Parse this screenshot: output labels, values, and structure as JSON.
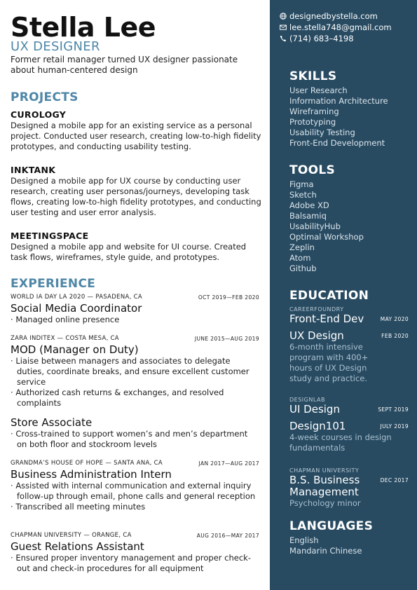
{
  "header": {
    "name": "Stella Lee",
    "role": "UX DESIGNER",
    "intro": "Former retail manager turned UX designer passionate about human-centered design"
  },
  "projects": {
    "title": "PROJECTS",
    "items": [
      {
        "name": "CUROLOGY",
        "desc": "Designed a mobile app for an existing service as a personal project. Conducted user research, creating low-to-high fidelity prototypes, and conducting usability testing."
      },
      {
        "name": "INKTANK",
        "desc": "Designed a mobile app for UX course by conducting user research, creating user personas/journeys, developing task flows, creating low-to-high fidelity prototypes, and conducting user testing and user error analysis."
      },
      {
        "name": "MEETINGSPACE",
        "desc": "Designed a mobile app and website for UI course.  Created task flows, wireframes, style guide, and prototypes."
      }
    ]
  },
  "experience": {
    "title": "EXPERIENCE",
    "jobs": [
      {
        "org": "WORLD IA DAY LA 2020 — PASADENA, CA",
        "date": "OCT 2019—FEB 2020",
        "title": "Social Media Coordinator",
        "bullets": [
          "Managed online presence"
        ]
      },
      {
        "org": "ZARA INDITEX — COSTA MESA, CA",
        "date": "JUNE 2015—AUG 2019",
        "title": "MOD (Manager on Duty)",
        "bullets": [
          "Liaise between managers and associates to delegate duties,  coordinate breaks, and ensure excellent customer service",
          "Authorized cash returns & exchanges, and resolved complaints"
        ]
      },
      {
        "org": "",
        "date": "",
        "title": "Store Associate",
        "bullets": [
          "Cross-trained to support women’s and men’s department on both floor and stockroom levels"
        ]
      },
      {
        "org": "GRANDMA’S HOUSE OF HOPE — SANTA ANA, CA",
        "date": "JAN 2017—AUG 2017",
        "title": "Business Administration Intern",
        "bullets": [
          "Assisted with internal communication and external inquiry follow-up through email, phone calls and general reception",
          "Transcribed all meeting minutes"
        ]
      },
      {
        "org": "CHAPMAN UNIVERSITY — ORANGE, CA",
        "date": "AUG 2016—MAY 2017",
        "title": "Guest Relations Assistant",
        "bullets": [
          "Ensured proper inventory management and proper check-out and check-in procedures for all equipment"
        ]
      }
    ]
  },
  "contact": {
    "website": "designedbystella.com",
    "email": "lee.stella748@gmail.com",
    "phone": "(714) 683–4198",
    "icons": [
      "globe-icon",
      "mail-icon",
      "phone-icon"
    ]
  },
  "skills": {
    "title": "SKILLS",
    "items": [
      "User Research",
      "Information Architecture",
      "Wireframing",
      "Prototyping",
      "Usability Testing",
      "Front-End Development"
    ]
  },
  "tools": {
    "title": "TOOLS",
    "items": [
      "Figma",
      "Sketch",
      "Adobe XD",
      "Balsamiq",
      "UsabilityHub",
      "Optimal Workshop",
      "Zeplin",
      "Atom",
      "Github"
    ]
  },
  "education": {
    "title": "EDUCATION",
    "entries": [
      {
        "school": "CAREERFOUNDRY",
        "degree": "Front-End Dev",
        "date": "MAY 2020",
        "note": ""
      },
      {
        "school": "",
        "degree": "UX Design",
        "date": "FEB 2020",
        "note": "6-month intensive program with 400+ hours of UX Design study and practice."
      },
      {
        "school": "DESIGNLAB",
        "degree": "UI Design",
        "date": "SEPT 2019",
        "note": ""
      },
      {
        "school": "",
        "degree": "Design101",
        "date": "JULY 2019",
        "note": "4-week courses in design fundamentals"
      },
      {
        "school": "CHAPMAN UNIVERSITY",
        "degree": "B.S. Business Management",
        "date": "DEC 2017",
        "note": "Psychology minor"
      }
    ]
  },
  "languages": {
    "title": "LANGUAGES",
    "items": [
      "English",
      "Mandarin Chinese"
    ]
  },
  "colors": {
    "accent": "#4f87a7",
    "sidebar": "#284b62"
  }
}
